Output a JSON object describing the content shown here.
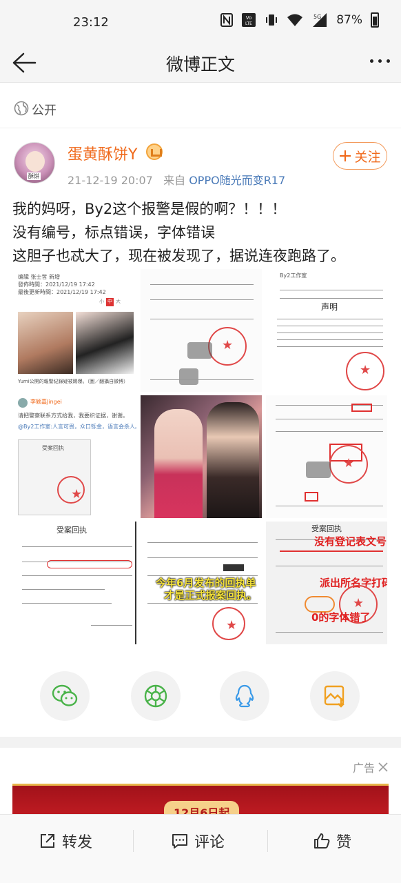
{
  "status_bar": {
    "time": "23:12",
    "volte_label": "Vo LTE",
    "network_label": "5G",
    "battery": "87%"
  },
  "nav": {
    "title": "微博正文"
  },
  "visibility": {
    "label": "公开"
  },
  "post": {
    "author": "蛋黄酥饼Y",
    "avatar_tag": "酥饼",
    "follow_label": "关注",
    "time": "21-12-19 20:07",
    "source_prefix": "来自",
    "source": "OPPO随光而变R17",
    "lines": [
      "我的妈呀，By2这个报警是假的啊？！！！",
      "没有编号，标点错误，字体错误",
      "这胆子也忒大了，现在被发现了，据说连夜跑路了。"
    ]
  },
  "images": {
    "img1": {
      "line1": "编辑 张士哲 新增",
      "line2": "發佈時間：2021/12/19 17:42",
      "line3": "最後更新時間：2021/12/19 17:42",
      "caption": "Yumi公開的報警紀錄疑被踢爆。（圖／翻攝自微博）"
    },
    "img3": {
      "user": "By2工作室",
      "heading": "声明"
    },
    "img4": {
      "user": "李颖嘉Jingei",
      "text1": "请把警察联系方式给我，我要织证据，谢谢。",
      "text2": "@By2工作室:人言可畏，众口铄金，语言会杀人。",
      "doc_title": "受案回执"
    },
    "img7": {
      "title": "受案回执"
    },
    "img8": {
      "overlay1": "今年6月发布的回执单",
      "overlay2": "才是正式报案回执。"
    },
    "img9": {
      "title": "受案回执",
      "note1": "没有登记表文号",
      "note2": "派出所名字打码",
      "note3": "0的字体错了"
    }
  },
  "share": {
    "buttons": [
      "wechat-icon",
      "moments-icon",
      "qq-icon",
      "save-image-icon"
    ]
  },
  "ad": {
    "label": "广告",
    "banner_text": "12月6日起"
  },
  "bottom_bar": {
    "repost": "转发",
    "comment": "评论",
    "like": "赞"
  },
  "colors": {
    "accent": "#f06a1c",
    "link": "#4a7ab8",
    "stamp": "#e04848"
  }
}
